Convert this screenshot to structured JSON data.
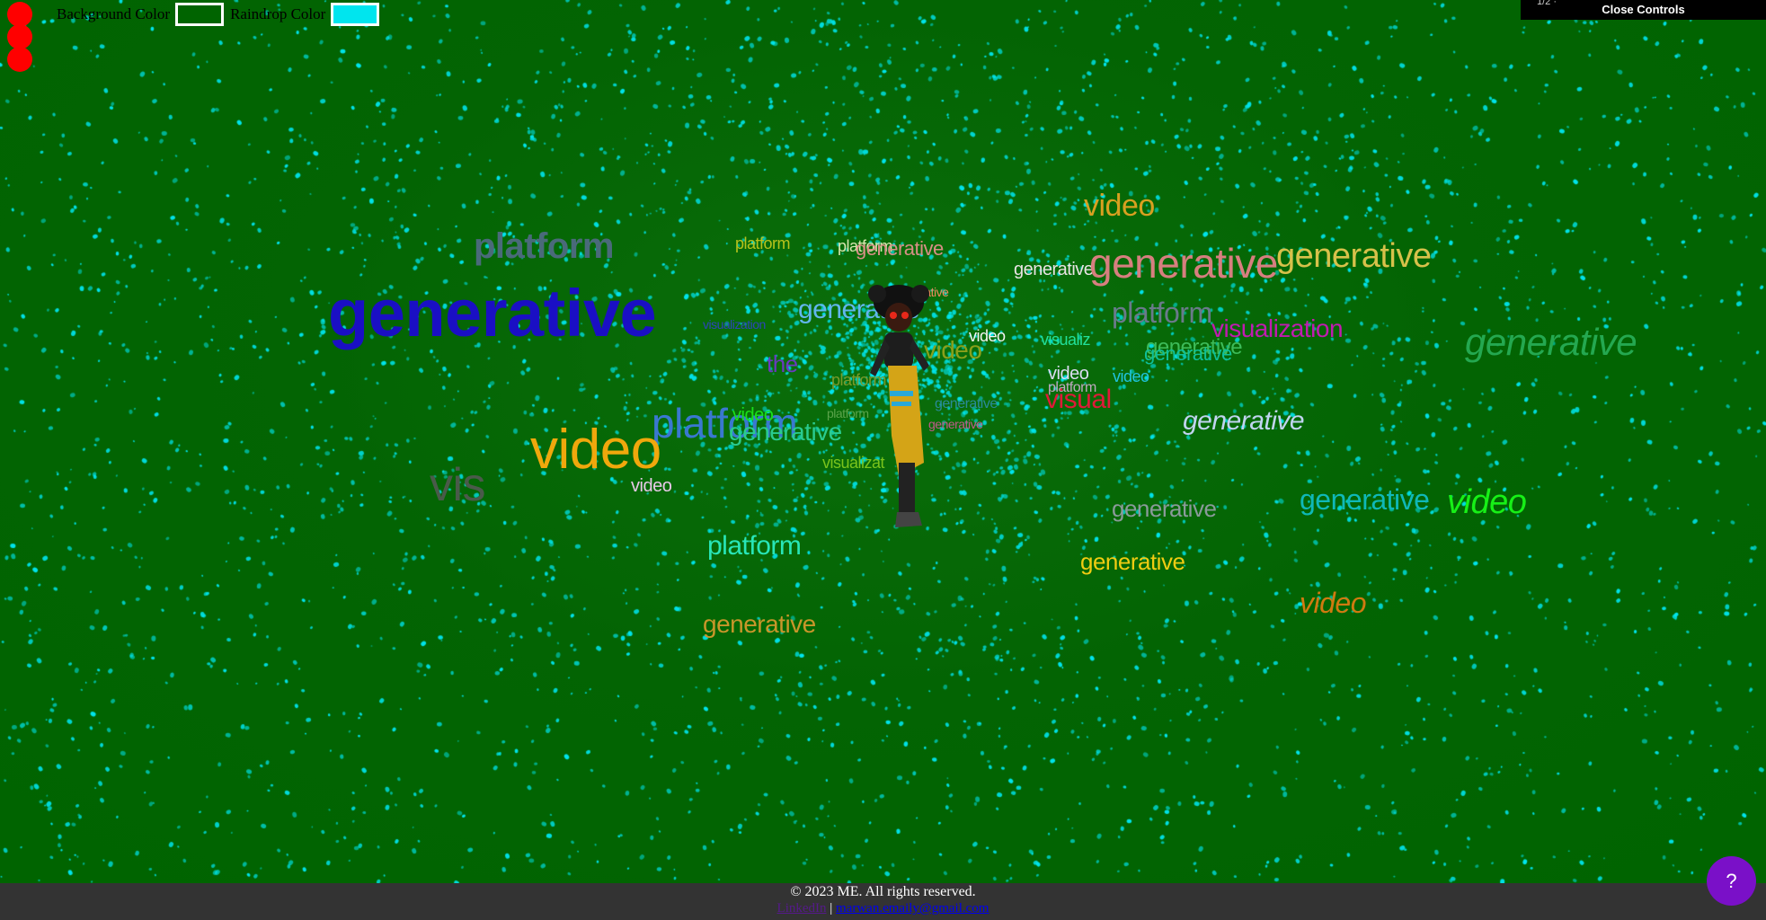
{
  "controls": {
    "background_label": "Background Color",
    "background_color": "#006400",
    "raindrop_label": "Raindrop Color",
    "raindrop_color": "#00e5ee",
    "close_label": "Close Controls",
    "close_sliver": "1/2 ·"
  },
  "scene": {
    "word_cloud": [
      {
        "text": "generative",
        "color": "#1a0fc4"
      },
      {
        "text": "platform",
        "color": "#4a6a7a"
      },
      {
        "text": "platform",
        "color": "#b7c21c"
      },
      {
        "text": "platform",
        "color": "#d8e6b0"
      },
      {
        "text": "generative",
        "color": "#d88f86"
      },
      {
        "text": "video",
        "color": "#d8a020"
      },
      {
        "text": "generative",
        "color": "#e9e3e3"
      },
      {
        "text": "generative",
        "color": "#d77f7f"
      },
      {
        "text": "generative",
        "color": "#d7c14a"
      },
      {
        "text": "generative",
        "color": "#62b6ee"
      },
      {
        "text": "visualization",
        "color": "#2c45b8"
      },
      {
        "text": "generative",
        "color": "#ec8a5c"
      },
      {
        "text": "platform",
        "color": "#6a7a8a"
      },
      {
        "text": "visualization",
        "color": "#c11bb0"
      },
      {
        "text": "generative",
        "color": "#3dbb59"
      },
      {
        "text": "video",
        "color": "#f4f4f4"
      },
      {
        "text": "visualiz",
        "color": "#22e09a"
      },
      {
        "text": "generative",
        "color": "#0fbf9a"
      },
      {
        "text": "video",
        "color": "#20c4e0"
      },
      {
        "text": "video",
        "color": "#8aa01b"
      },
      {
        "text": "the",
        "color": "#6a3abf"
      },
      {
        "text": "video",
        "color": "#dcdcf4"
      },
      {
        "text": "platform",
        "color": "#7a9a2a"
      },
      {
        "text": "platform",
        "color": "#c0a8c0"
      },
      {
        "text": "visual",
        "color": "#e01a38"
      },
      {
        "text": "generative",
        "color": "#2a8a9a"
      },
      {
        "text": "platform",
        "color": "#3a78d0"
      },
      {
        "text": "video",
        "color": "#1ae01a"
      },
      {
        "text": "platform",
        "color": "#5aa34a"
      },
      {
        "text": "generative",
        "color": "#c05a8a"
      },
      {
        "text": "generative",
        "color": "#2acb8f"
      },
      {
        "text": "generative",
        "color": "#c0d4f0"
      },
      {
        "text": "video",
        "color": "#f0a80c"
      },
      {
        "text": "vis",
        "color": "#4a5a4a"
      },
      {
        "text": "video",
        "color": "#e8c8e8"
      },
      {
        "text": "visualizat",
        "color": "#7ac31c"
      },
      {
        "text": "generative",
        "color": "#8a9a9a"
      },
      {
        "text": "generative",
        "color": "#0fb8b8"
      },
      {
        "text": "video",
        "color": "#17f017"
      },
      {
        "text": "platform",
        "color": "#28e6b8"
      },
      {
        "text": "generative",
        "color": "#f0cc12"
      },
      {
        "text": "video",
        "color": "#d07a10"
      },
      {
        "text": "generative",
        "color": "#c8962a"
      },
      {
        "text": "generative",
        "color": "#24a850"
      }
    ]
  },
  "footer": {
    "copyright": "© 2023 ME. All rights reserved.",
    "linkedin_label": "LinkedIn",
    "separator": "|",
    "email_label": "marwan.emaily@gmail.com"
  },
  "help": {
    "label": "?",
    "color": "#7a10c8"
  }
}
